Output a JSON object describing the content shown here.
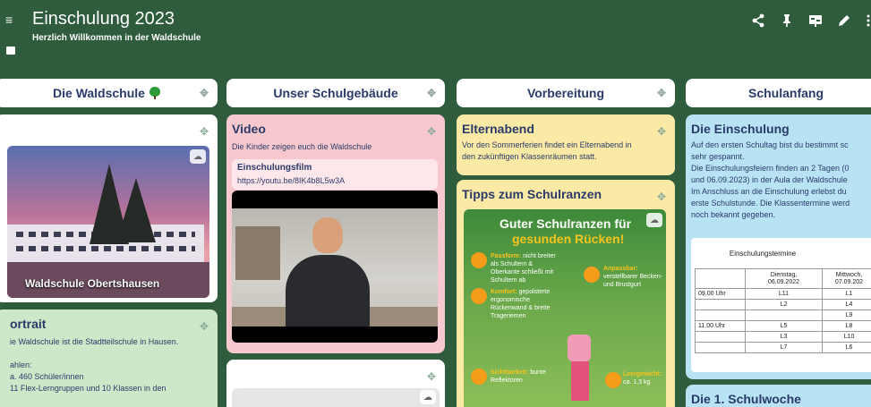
{
  "board": {
    "title": "Einschulung 2023",
    "subtitle": "Herzlich Willkommen in der Waldschule"
  },
  "actions": [
    "share-icon",
    "pin-icon",
    "slideshow-icon",
    "edit-icon"
  ],
  "columns": [
    {
      "title": "Die Waldschule"
    },
    {
      "title": "Unser Schulgebäude"
    },
    {
      "title": "Vorbereitung"
    },
    {
      "title": "Schulanfang"
    }
  ],
  "col1": {
    "photo_label": "Waldschule Obertshausen",
    "portrait": {
      "title": "ortrait",
      "lines": [
        "ie Waldschule ist die Stadtteilschule in Hausen.",
        "",
        "ahlen:",
        "a. 460 Schüler/innen",
        " 11 Flex-Lerngruppen und  10 Klassen in den"
      ]
    }
  },
  "col2": {
    "video": {
      "title": "Video",
      "text": "Die Kinder zeigen euch die Waldschule",
      "link_title": "Einschulungsfilm",
      "link_url": "https://youtu.be/8IK4b8L5w3A"
    }
  },
  "col3": {
    "elternabend": {
      "title": "Elternabend",
      "lines": [
        "Vor den Sommerferien findet ein Elternabend in",
        "den zukünftigen Klassenräumen statt."
      ]
    },
    "tipps": {
      "title": "Tipps zum Schulranzen",
      "poster_title_1": "Guter Schulranzen für",
      "poster_title_2": "gesunden Rücken!",
      "items": [
        {
          "label": "Passform:",
          "text": "nicht breiter als Schultern & Oberkante schließt mit Schultern ab"
        },
        {
          "label": "Anpassbar:",
          "text": "verstellbarer Becken- und Brustgurt"
        },
        {
          "label": "Komfort:",
          "text": "gepolsterte ergonomische Rückenwand & breite Trageriemen"
        },
        {
          "label": "Sichtbarkeit:",
          "text": "bunte Reflektoren"
        },
        {
          "label": "Leergewicht:",
          "text": "ca. 1,3 kg"
        }
      ]
    }
  },
  "col4": {
    "einschulung": {
      "title": "Die Einschulung",
      "lines": [
        "Auf den ersten Schultag bist du bestimmt sc",
        "sehr gespannt.",
        "Die Einschulungsfeiern finden an 2 Tagen (0",
        "und 06.09.2023) in der Aula der Waldschule",
        "Im Anschluss an die Einschulung erlebst du",
        "erste Schulstunde. Die Klassentermine werd",
        "noch bekannt gegeben."
      ],
      "schedule": {
        "title": "Einschulungstermine",
        "day1": [
          "Dienstag,",
          "06.09.2022"
        ],
        "day2": [
          "Mittwoch,",
          "07.09.202"
        ],
        "rows": [
          [
            "09.00 Uhr",
            "L11",
            "L1"
          ],
          [
            "",
            "L2",
            "L4"
          ],
          [
            "",
            "",
            "L9"
          ],
          [
            "11.00 Uhr",
            "L5",
            "L8"
          ],
          [
            "",
            "L3",
            "L10"
          ],
          [
            "",
            "L7",
            "L6"
          ]
        ]
      }
    },
    "woche": {
      "title": "Die 1. Schulwoche"
    }
  },
  "colors": {
    "background": "#2f5c3c",
    "pink": "#f7c9ce",
    "green": "#cde8c9",
    "yellow": "#fbe9a6",
    "blue": "#b8e3f5"
  }
}
